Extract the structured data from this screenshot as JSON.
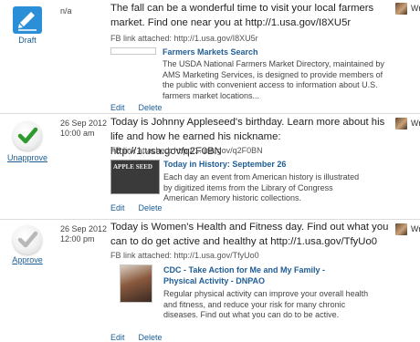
{
  "posts": [
    {
      "status_label": "Draft",
      "date": "n/a",
      "time": "",
      "message": "The fall can be a wonderful time to visit your local farmers market. Find one near you at http://1.usa.gov/I8XU5r",
      "fb_link": "FB link attached: http://1.usa.gov/I8XU5r",
      "link_title": "Farmers Markets Search",
      "link_desc": "The USDA National Farmers Market Directory, maintained by AMS Marketing Services, is designed to provide members of the public with convenient access to information about U.S. farmers market locations...",
      "edit": "Edit",
      "delete": "Delete",
      "author": "Wr"
    },
    {
      "status_label": "Unapprove",
      "date": "26 Sep 2012",
      "time": "10:00 am",
      "message": "Today is Johnny Appleseed's birthday. Learn more about his life and how he earned his nickname: http://1.usa.gov/q2F0BN",
      "fb_link": "FB link attached: http://1.usa.gov/q2F0BN",
      "link_title": "Today in History: September 26",
      "link_desc": "Each day an event from American history is illustrated by digitized items from the Library of Congress American Memory historic collections.",
      "thumb_text": "APPLE SEED",
      "edit": "Edit",
      "delete": "Delete",
      "author": "Wr"
    },
    {
      "status_label": "Approve",
      "date": "26 Sep 2012",
      "time": "12:00 pm",
      "message": "Today is Women's Health and Fitness day. Find out what you can to do get active and healthy at http://1.usa.gov/TfyUo0",
      "fb_link": "FB link attached: http://1.usa.gov/TfyUo0",
      "link_title": "CDC - Take Action for Me and My Family - Physical Activity - DNPAO",
      "link_desc": "Regular physical activity can improve your overall health and fitness, and reduce your risk for many chronic diseases. Find out what you can do to be active.",
      "edit": "Edit",
      "delete": "Delete",
      "author": "Wr"
    }
  ],
  "colors": {
    "link_blue": "#1a5d94",
    "approved_green": "#2e9a2e",
    "pending_grey": "#b8b8b8",
    "draft_blue": "#2a8fd6"
  },
  "icons": [
    "draft-pencil-icon",
    "checkmark-green-icon",
    "checkmark-grey-icon",
    "avatar-icon"
  ]
}
